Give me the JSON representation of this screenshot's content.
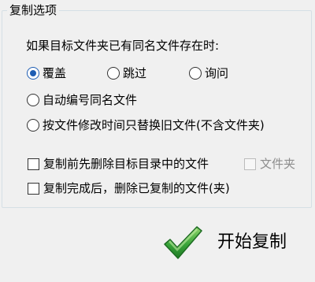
{
  "group": {
    "title": "复制选项",
    "conflict_prompt": "如果目标文件夹已有同名文件存在时:"
  },
  "conflict_options": {
    "overwrite": {
      "label": "覆盖",
      "selected": true
    },
    "skip": {
      "label": "跳过",
      "selected": false
    },
    "ask": {
      "label": "询问",
      "selected": false
    },
    "auto_rename": {
      "label": "自动编号同名文件",
      "selected": false
    },
    "replace_older": {
      "label": "按文件修改时间只替换旧文件(不含文件夹)",
      "selected": false
    }
  },
  "checkboxes": {
    "delete_before": {
      "label": "复制前先删除目标目录中的文件",
      "checked": false
    },
    "folders": {
      "label": "文件夹",
      "checked": false,
      "disabled": true
    },
    "delete_after": {
      "label": "复制完成后，删除已复制的文件(夹)",
      "checked": false
    }
  },
  "start_button": {
    "label": "开始复制",
    "icon": "checkmark-icon",
    "icon_color": "#3aa53a"
  },
  "colors": {
    "accent": "#1e5db3",
    "group_border": "#d5dfe5",
    "disabled_text": "#8d8d8d"
  }
}
